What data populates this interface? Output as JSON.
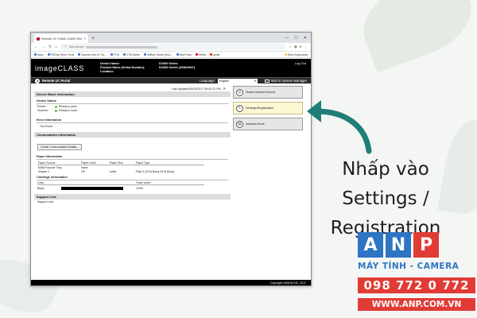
{
  "browser": {
    "tab_title": "Remote UI: Portal: D1600 Series",
    "tab_close": "×",
    "new_tab": "+",
    "window_controls": [
      "—",
      "☐",
      "✕"
    ],
    "nav_icons": [
      "←",
      "→",
      "↻",
      "⌂"
    ],
    "url_prefix": "Not secure",
    "bookmarks": [
      "Apps",
      "PDGhg Hirnex Tools",
      "Scanner dlla 10 Tra...",
      "CTM",
      "CTM Admin",
      "William Sonell (SLA...",
      "Bad Proxs",
      "Netflix",
      "gmail"
    ],
    "bookmarks_other": "Other bookmarks"
  },
  "canon": {
    "logo": "imageCLASS",
    "device_name_label": "Device Name:",
    "device_name": "D1600 Series",
    "product_name_label": "Product Name (Serial Number):",
    "product_name": "D1600 Series (2SN04947)",
    "location_label": "Location:",
    "logout": "Log Out",
    "portal_title": "Remote UI: Portal",
    "language_label": "Language:",
    "language": "English",
    "mail_label": "Mail to System Manager",
    "last_updated": "Last Updated:05/24/2017 05:02:21 PM",
    "device_basic_info": "Device Basic Information",
    "device_status": "Device Status",
    "printer_label": "Printer:",
    "printer_status": "Ready to print.",
    "scanner_label": "Scanner:",
    "scanner_status": "Ready to scan.",
    "error_info": "Error Information",
    "no_errors": "No errors.",
    "consumables_info": "Consumables Information",
    "check_consumables": "Check Consumables Details...",
    "paper_info": "Paper Information",
    "paper_headers": [
      "Paper Source",
      "Paper Level",
      "Paper Size",
      "Paper Type"
    ],
    "paper_rows": [
      [
        "Multi-Purpose Tray",
        "None",
        "",
        ""
      ],
      [
        "Drawer 1",
        "OK",
        "Letter",
        "Plain 2 (20 lb Bond-23 lb Bond)"
      ]
    ],
    "cartridge_info": "Cartridge Information",
    "cartridge_headers": [
      "Color",
      "Toner Level"
    ],
    "cartridge_color": "Black",
    "toner_level": "100%",
    "toner_fraction": 1.0,
    "support_link_h": "Support Link",
    "support_link": "Support Link",
    "nav_status": "Status Monitor/Cancel",
    "nav_settings": "Settings/Registration",
    "nav_address": "Address Book",
    "copyright": "Copyright CANON INC. 2017"
  },
  "overlay": {
    "caption_1": "Nhấp vào",
    "caption_2": "Settings /",
    "caption_3": "Registration",
    "logo_a": "A",
    "logo_n": "N",
    "logo_p": "P",
    "tagline": "MÁY TÍNH - CAMERA",
    "phone": "098 772 0 772",
    "website": "WWW.ANP.COM.VN"
  },
  "colors": {
    "arrow": "#1f7f78",
    "brand_blue": "#2d74c4",
    "brand_red": "#e13b35",
    "status_ok": "#5bbd3a",
    "active_nav": "#fdf7d4"
  }
}
